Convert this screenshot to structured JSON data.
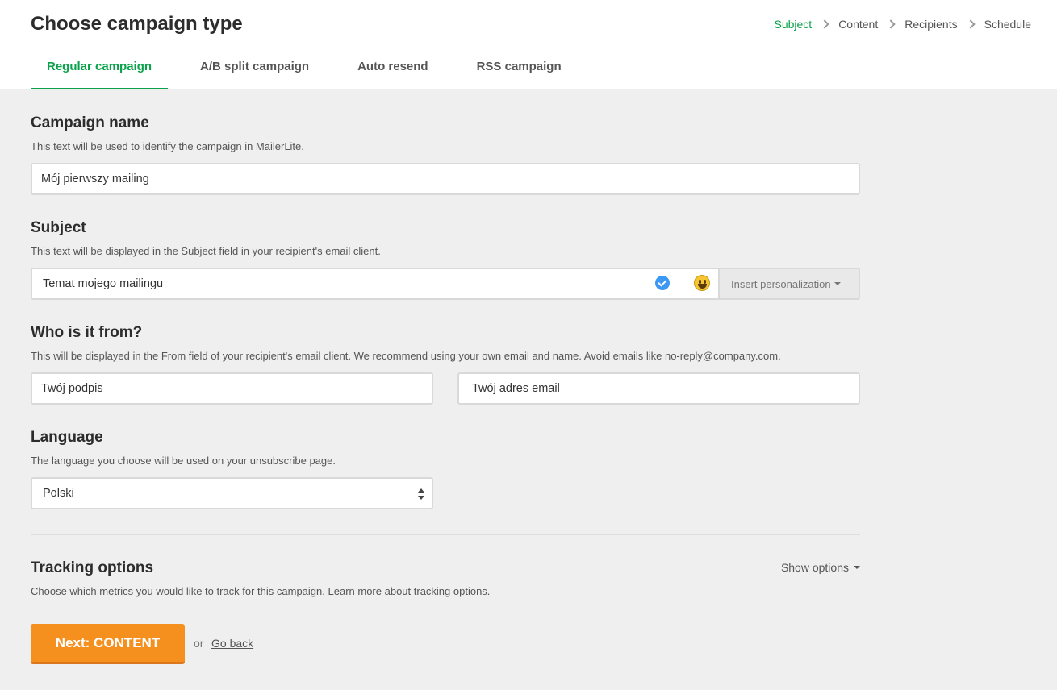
{
  "page_title": "Choose campaign type",
  "breadcrumb": {
    "steps": [
      "Subject",
      "Content",
      "Recipients",
      "Schedule"
    ],
    "active_step": "Subject"
  },
  "tabs": [
    "Regular campaign",
    "A/B split campaign",
    "Auto resend",
    "RSS campaign"
  ],
  "active_tab": "Regular campaign",
  "campaign_name": {
    "title": "Campaign name",
    "hint": "This text will be used to identify the campaign in MailerLite.",
    "value": "Mój pierwszy mailing"
  },
  "subject": {
    "title": "Subject",
    "hint": "This text will be displayed in the Subject field in your recipient's email client.",
    "value": "Temat mojego mailingu",
    "insert_personalization": "Insert personalization"
  },
  "from": {
    "title": "Who is it from?",
    "hint": "This will be displayed in the From field of your recipient's email client. We recommend using your own email and name. Avoid emails like no-reply@company.com.",
    "name_value": "Twój podpis",
    "email_value": "Twój adres email"
  },
  "language": {
    "title": "Language",
    "hint": "The language you choose will be used on your unsubscribe page.",
    "selected": "Polski"
  },
  "tracking": {
    "title": "Tracking options",
    "hint": "Choose which metrics you would like to track for this campaign.",
    "learn_more": "Learn more about tracking options.",
    "show_options": "Show options"
  },
  "footer": {
    "next_label": "Next: CONTENT",
    "or_text": "or",
    "go_back": "Go back"
  },
  "colors": {
    "accent_green": "#09a24a",
    "button_orange": "#f5901e",
    "verify_blue": "#3b98f5"
  },
  "icons": [
    "chevron-right-icon",
    "verified-check-icon",
    "emoji-smiley-icon",
    "caret-down-icon",
    "select-arrows-icon"
  ]
}
